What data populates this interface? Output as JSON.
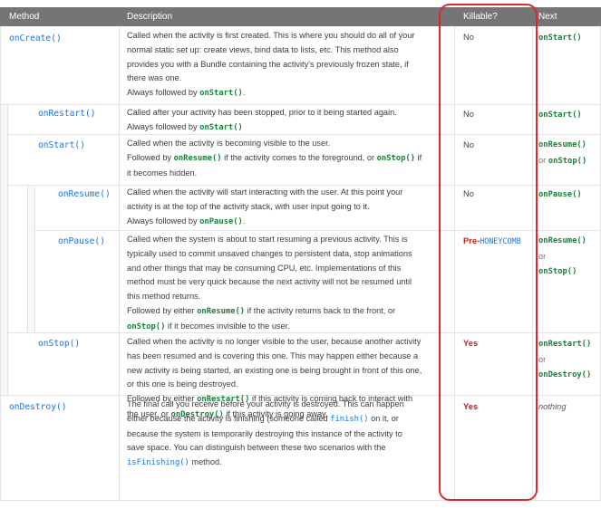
{
  "header": {
    "method": "Method",
    "description": "Description",
    "killable": "Killable?",
    "next": "Next"
  },
  "rows": [
    {
      "method": "onCreate()",
      "desc_lines": [
        "Called when the activity is first created. This is where you should do all of your",
        "normal static set up: create views, bind data to lists, etc. This method also",
        "provides you with a Bundle containing the activity's previously frozen state, if",
        "there was one."
      ],
      "followed_prefix": "Always followed by ",
      "followed_code": "onStart()",
      "followed_suffix": ".",
      "killable": "No",
      "next": "onStart()"
    },
    {
      "method": "onRestart()",
      "desc_lines": [
        "Called after your activity has been stopped, prior to it being started again."
      ],
      "followed_prefix": "Always followed by ",
      "followed_code": "onStart()",
      "followed_suffix": "",
      "killable": "No",
      "next": "onStart()"
    },
    {
      "method": "onStart()",
      "desc_lines": [
        "Called when the activity is becoming visible to the user."
      ],
      "line2_prefix": "Followed by ",
      "line2_code1": "onResume()",
      "line2_mid": " if the activity comes to the foreground, or ",
      "line2_code2": "onStop()",
      "line2_suffix": " if",
      "line3": "it becomes hidden.",
      "killable": "No",
      "next1": "onResume()",
      "next_or": "or",
      "next2": "onStop()"
    },
    {
      "method": "onResume()",
      "desc_lines": [
        "Called when the activity will start interacting with the user. At this point your",
        "activity is at the top of the activity stack, with user input going to it."
      ],
      "followed_prefix": "Always followed by ",
      "followed_code": "onPause()",
      "followed_suffix": ".",
      "killable": "No",
      "next": "onPause()"
    },
    {
      "method": "onPause()",
      "desc_lines": [
        "Called when the system is about to start resuming a previous activity. This is",
        "typically used to commit unsaved changes to persistent data, stop animations",
        "and other things that may be consuming CPU, etc. Implementations of this",
        "method must be very quick because the next activity will not be resumed until",
        "this method returns."
      ],
      "f1_prefix": "Followed by either ",
      "f1_code": "onResume()",
      "f1_suffix": " if the activity returns back to the front, or",
      "f2_code": "onStop()",
      "f2_suffix": " if it becomes invisible to the user.",
      "killable_pre": "Pre-",
      "killable_code": "HONEYCOMB",
      "next1": "onResume()",
      "next_or": "or",
      "next2": "onStop()"
    },
    {
      "method": "onStop()",
      "desc_lines": [
        "Called when the activity is no longer visible to the user, because another activity",
        "has been resumed and is covering this one. This may happen either because a",
        "new activity is being started, an existing one is being brought in front of this one,",
        "or this one is being destroyed."
      ],
      "f1_prefix": "Followed by either ",
      "f1_code": "onRestart()",
      "f1_suffix": " if this activity is coming back to interact with",
      "f2_prefix": "the user, or ",
      "f2_code": "onDestroy()",
      "f2_suffix": " if this activity is going away.",
      "killable": "Yes",
      "next1": "onRestart()",
      "next_or": "or",
      "next2": "onDestroy()"
    },
    {
      "method": "onDestroy()",
      "l1": "The final call you receive before your activity is destroyed. This can happen",
      "l2_prefix": "either because the activity is finishing (someone called ",
      "l2_code": "finish()",
      "l2_suffix": " on it, or",
      "l3": "because the system is temporarily destroying this instance of the activity to",
      "l4": "save space. You can distinguish between these two scenarios with the",
      "l5_code": "isFinishing()",
      "l5_suffix": " method.",
      "killable": "Yes",
      "next": "nothing"
    }
  ],
  "colors": {
    "header_bg": "#757575",
    "method_blue": "#1a73e8",
    "code_green": "#188038",
    "killable_red": "#c5221f",
    "highlight_box": "#e0252d"
  }
}
